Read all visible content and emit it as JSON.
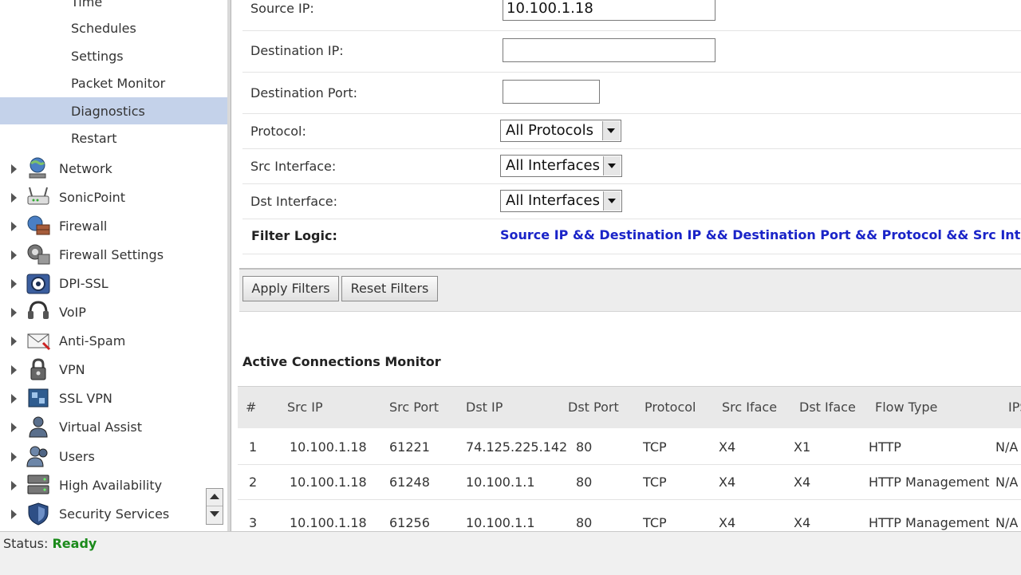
{
  "sidebar": {
    "sub_items": [
      {
        "label": "Time"
      },
      {
        "label": "Schedules"
      },
      {
        "label": "Settings"
      },
      {
        "label": "Packet Monitor"
      },
      {
        "label": "Diagnostics",
        "selected": true
      },
      {
        "label": "Restart"
      }
    ],
    "nav_items": [
      {
        "label": "Network",
        "icon": "globe-icon"
      },
      {
        "label": "SonicPoint",
        "icon": "access-point-icon"
      },
      {
        "label": "Firewall",
        "icon": "firewall-icon"
      },
      {
        "label": "Firewall Settings",
        "icon": "firewall-settings-icon"
      },
      {
        "label": "DPI-SSL",
        "icon": "dpi-ssl-icon"
      },
      {
        "label": "VoIP",
        "icon": "headset-icon"
      },
      {
        "label": "Anti-Spam",
        "icon": "envelope-icon"
      },
      {
        "label": "VPN",
        "icon": "lock-icon"
      },
      {
        "label": "SSL VPN",
        "icon": "ssl-vpn-icon"
      },
      {
        "label": "Virtual Assist",
        "icon": "user-icon"
      },
      {
        "label": "Users",
        "icon": "users-icon"
      },
      {
        "label": "High Availability",
        "icon": "servers-icon"
      },
      {
        "label": "Security Services",
        "icon": "shield-icon"
      }
    ]
  },
  "filters": {
    "source_ip": {
      "label": "Source IP:",
      "value": "10.100.1.18"
    },
    "destination_ip": {
      "label": "Destination IP:",
      "value": ""
    },
    "destination_port": {
      "label": "Destination Port:",
      "value": ""
    },
    "protocol": {
      "label": "Protocol:",
      "value": "All Protocols"
    },
    "src_interface": {
      "label": "Src Interface:",
      "value": "All Interfaces"
    },
    "dst_interface": {
      "label": "Dst Interface:",
      "value": "All Interfaces"
    },
    "filter_logic": {
      "label": "Filter Logic:",
      "value": "Source IP && Destination IP && Destination Port && Protocol && Src Interface"
    },
    "apply_label": "Apply Filters",
    "reset_label": "Reset Filters"
  },
  "connections": {
    "title": "Active Connections Monitor",
    "columns": [
      "#",
      "Src IP",
      "Src Port",
      "Dst IP",
      "Dst Port",
      "Protocol",
      "Src Iface",
      "Dst Iface",
      "Flow Type",
      "IPS"
    ],
    "rows": [
      [
        "1",
        "10.100.1.18",
        "61221",
        "74.125.225.142",
        "80",
        "TCP",
        "X4",
        "X1",
        "HTTP",
        "N/A"
      ],
      [
        "2",
        "10.100.1.18",
        "61248",
        "10.100.1.1",
        "80",
        "TCP",
        "X4",
        "X4",
        "HTTP Management",
        "N/A"
      ],
      [
        "3",
        "10.100.1.18",
        "61256",
        "10.100.1.1",
        "80",
        "TCP",
        "X4",
        "X4",
        "HTTP Management",
        "N/A"
      ]
    ]
  },
  "status": {
    "label": "Status:",
    "value": "Ready"
  },
  "colors": {
    "selected_bg": "#c4d2ea",
    "filter_logic_text": "#1a24c8",
    "status_ready": "#1b8a1b"
  }
}
